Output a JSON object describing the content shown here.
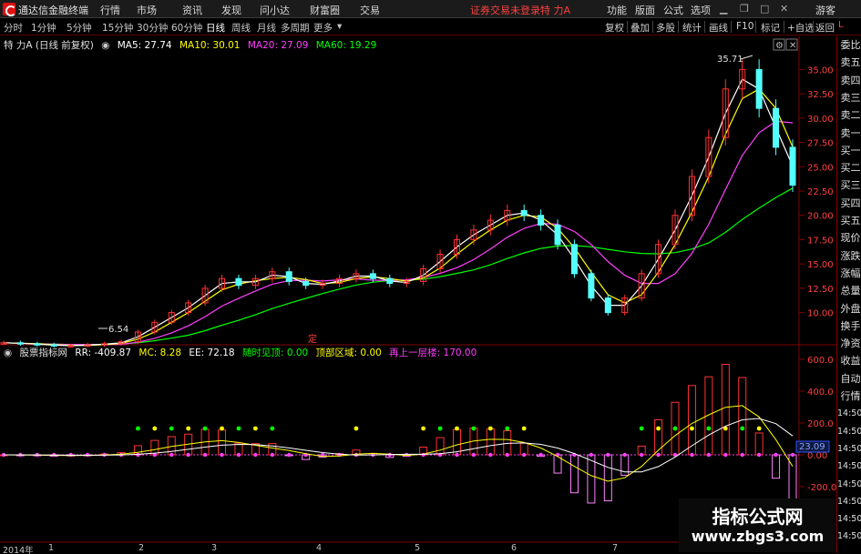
{
  "menubar": {
    "app_name": "通达信金融终端",
    "menus": [
      "行情",
      "市场",
      "资讯",
      "发现",
      "问小达",
      "财富圈",
      "交易"
    ],
    "login_warning": "证券交易未登录",
    "stock_name": "特 力A",
    "right_menus": [
      "功能",
      "版面",
      "公式",
      "选项"
    ],
    "guest_label": "游客"
  },
  "periodbar": {
    "periods": [
      "分时",
      "1分钟",
      "5分钟",
      "15分钟",
      "30分钟",
      "60分钟",
      "日线",
      "周线",
      "月线",
      "多周期",
      "更多"
    ],
    "active_period": "日线",
    "tools": [
      "复权",
      "叠加",
      "多股",
      "统计",
      "画线",
      "F10",
      "标记",
      "+自选",
      "返回"
    ]
  },
  "ma_legend": {
    "title": "特 力A (日线 前复权)",
    "ma5": "MA5: 27.74",
    "ma10": "MA10: 30.01",
    "ma20": "MA20: 27.09",
    "ma60": "MA60: 19.29"
  },
  "indicator_legend": {
    "name": "股票指标网",
    "rr": "RR: -409.87",
    "mc": "MC: 8.28",
    "ee": "EE: 72.18",
    "t1": "随时见顶: 0.00",
    "t2": "顶部区域: 0.00",
    "t3": "再上一层楼: 170.00"
  },
  "price_axis": [
    "35.00",
    "32.50",
    "30.00",
    "27.50",
    "25.00",
    "22.50",
    "20.00",
    "17.50",
    "15.00",
    "12.50",
    "10.00"
  ],
  "indicator_axis": [
    "600.0",
    "400.0",
    "200.0",
    "0.00",
    "-200.0"
  ],
  "annotations": {
    "high": "35.71",
    "low": "6.54",
    "marker": "定",
    "current_value": "23.09"
  },
  "dates": [
    "2014年",
    "1",
    "2",
    "3",
    "4",
    "5",
    "6",
    "7"
  ],
  "sidebar": {
    "badge": "L",
    "items": [
      "委比",
      "卖五",
      "卖四",
      "卖三",
      "卖二",
      "卖一",
      "买一",
      "买二",
      "买三",
      "买四",
      "买五",
      "现价",
      "涨跌",
      "涨幅",
      "总量",
      "外盘",
      "换手",
      "净资",
      "收益",
      "自动",
      "行情",
      "14:50",
      "14:50",
      "14:50",
      "14:50",
      "14:50",
      "14:50",
      "14:50",
      "14:50"
    ]
  },
  "watermark": {
    "title": "指标公式网",
    "url": "www.zbgs3.com"
  },
  "colors": {
    "ma5": "#ffffff",
    "ma10": "#ffff00",
    "ma20": "#ff40ff",
    "ma60": "#00ff00",
    "up": "#ff3232",
    "down": "#54ffff",
    "axis_red": "#800000"
  },
  "chart_data": {
    "type": "candlestick",
    "title": "特 力A (日线 前复权)",
    "ylim": [
      8,
      37
    ],
    "annotated_high": 35.71,
    "annotated_low": 6.54,
    "moving_averages": {
      "MA5": 27.74,
      "MA10": 30.01,
      "MA20": 27.09,
      "MA60": 19.29
    },
    "close_path_approx": [
      6.9,
      6.8,
      6.7,
      6.6,
      6.6,
      6.7,
      6.8,
      7.0,
      8.0,
      9.0,
      10.0,
      11.0,
      12.5,
      13.5,
      12.8,
      13.5,
      14.2,
      13.2,
      12.8,
      13.0,
      13.5,
      14.0,
      13.5,
      13.0,
      13.2,
      14.5,
      16.0,
      17.5,
      18.5,
      19.5,
      20.5,
      20.0,
      19.0,
      17.0,
      14.0,
      11.5,
      10.0,
      11.5,
      14.0,
      17.0,
      20.0,
      24.0,
      28.0,
      33.0,
      35.0,
      31.0,
      27.0,
      23.1
    ]
  }
}
